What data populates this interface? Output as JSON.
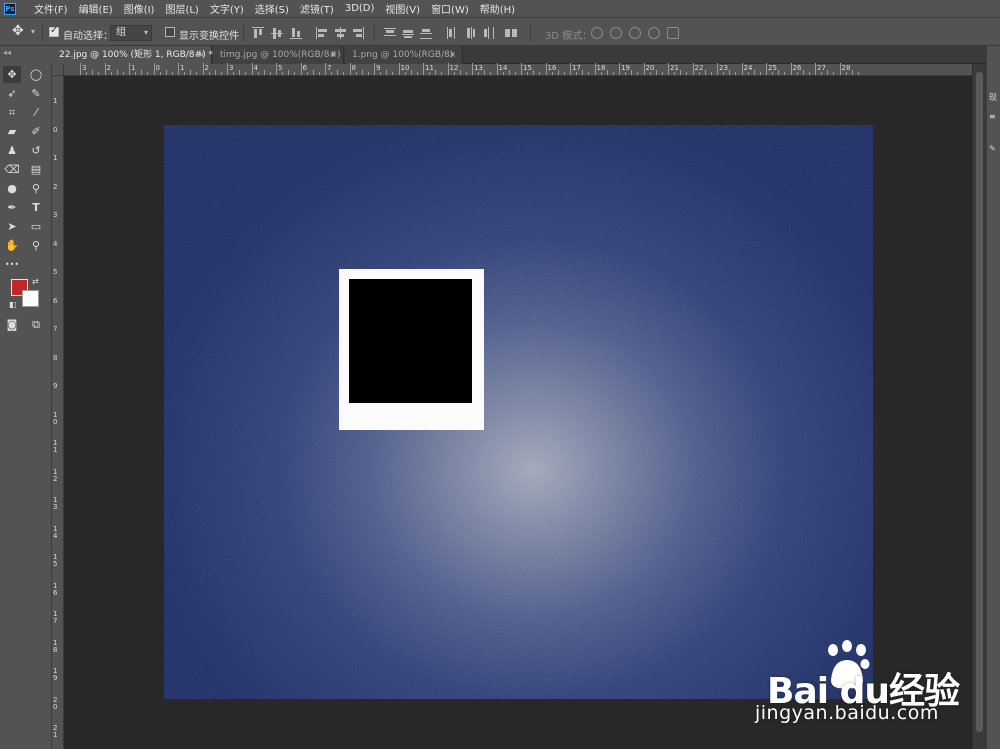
{
  "app": {
    "logo_text": "Ps"
  },
  "menu": [
    "文件(F)",
    "编辑(E)",
    "图像(I)",
    "图层(L)",
    "文字(Y)",
    "选择(S)",
    "滤镜(T)",
    "3D(D)",
    "视图(V)",
    "窗口(W)",
    "帮助(H)"
  ],
  "options_bar": {
    "auto_select_label": "自动选择：",
    "auto_select_checked": true,
    "group_value": "组",
    "show_transform_label": "显示变换控件",
    "show_transform_checked": false,
    "mode3d_label": "3D 模式："
  },
  "tabs": [
    {
      "label": "22.jpg @ 100% (矩形 1, RGB/8#) *",
      "close": "×",
      "active": true
    },
    {
      "label": "timg.jpg @ 100%(RGB/8#)",
      "close": "×",
      "active": false
    },
    {
      "label": "1.png @ 100%(RGB/8)",
      "close": "×",
      "active": false
    }
  ],
  "panel_strip_label": "◂◂",
  "colors": {
    "foreground": "#c2282b",
    "background": "#ffffff",
    "canvas_dark": "#192a63",
    "canvas_light": "#a3a9bc"
  },
  "rulers": {
    "horizontal_labels": [
      "3",
      "2",
      "1",
      "0",
      "1",
      "2",
      "3",
      "4",
      "5",
      "6",
      "7",
      "8",
      "9",
      "10",
      "11",
      "12",
      "13",
      "14",
      "15",
      "16",
      "17",
      "18",
      "19",
      "20",
      "21",
      "22",
      "23",
      "24",
      "25",
      "26",
      "27",
      "28"
    ],
    "vertical_labels": [
      "1",
      "0",
      "1",
      "2",
      "3",
      "4",
      "5",
      "6",
      "7",
      "8",
      "9",
      "1 0",
      "1 1",
      "1 2",
      "1 3",
      "1 4",
      "1 5",
      "1 6",
      "1 7",
      "1 8",
      "1 9",
      "2 0",
      "2 1"
    ]
  },
  "tools": [
    {
      "name": "move-tool",
      "glyph": "✥"
    },
    {
      "name": "marquee-tool",
      "glyph": "◯"
    },
    {
      "name": "lasso-tool",
      "glyph": "➶"
    },
    {
      "name": "quick-select-tool",
      "glyph": "✎"
    },
    {
      "name": "crop-tool",
      "glyph": "⌗"
    },
    {
      "name": "eyedropper-tool",
      "glyph": "⁄"
    },
    {
      "name": "healing-tool",
      "glyph": "▰"
    },
    {
      "name": "brush-tool",
      "glyph": "✐"
    },
    {
      "name": "stamp-tool",
      "glyph": "♟"
    },
    {
      "name": "history-brush-tool",
      "glyph": "↺"
    },
    {
      "name": "eraser-tool",
      "glyph": "⌫"
    },
    {
      "name": "gradient-tool",
      "glyph": "▤"
    },
    {
      "name": "blur-tool",
      "glyph": "●"
    },
    {
      "name": "dodge-tool",
      "glyph": "⚲"
    },
    {
      "name": "pen-tool",
      "glyph": "✒"
    },
    {
      "name": "type-tool",
      "glyph": "T"
    },
    {
      "name": "path-select-tool",
      "glyph": "➤"
    },
    {
      "name": "rectangle-tool",
      "glyph": "▭"
    },
    {
      "name": "hand-tool",
      "glyph": "✋"
    },
    {
      "name": "zoom-tool",
      "glyph": "⚲"
    },
    {
      "name": "more-tools",
      "glyph": "•••"
    },
    {
      "name": "quick-mask-tool",
      "glyph": "◙"
    },
    {
      "name": "screen-mode-tool",
      "glyph": "⧉"
    }
  ],
  "right_panel": {
    "labels": [
      "现",
      "≡"
    ]
  },
  "watermark": {
    "logo": "Bai  du经验",
    "url": "jingyan.baidu.com"
  }
}
